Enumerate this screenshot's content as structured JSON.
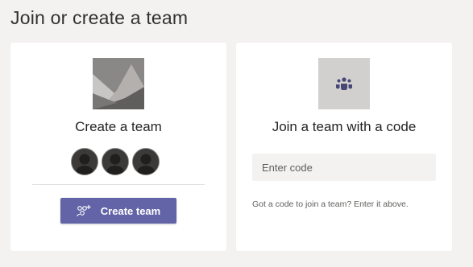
{
  "page": {
    "title": "Join or create a team"
  },
  "create_card": {
    "illustration_icon": "mountain-image-placeholder-icon",
    "title": "Create a team",
    "avatars": [
      "person-icon",
      "person-icon",
      "person-icon"
    ],
    "button_label": "Create team",
    "button_icon": "create-team-icon"
  },
  "join_card": {
    "icon": "teams-people-icon",
    "title": "Join a team with a code",
    "input_placeholder": "Enter code",
    "input_value": "",
    "hint": "Got a code to join a team? Enter it above."
  },
  "colors": {
    "background": "#f3f2f1",
    "card": "#ffffff",
    "accent": "#6264a7",
    "input_bg": "#f3f2f1",
    "icon_tile": "#d2d0ce"
  }
}
